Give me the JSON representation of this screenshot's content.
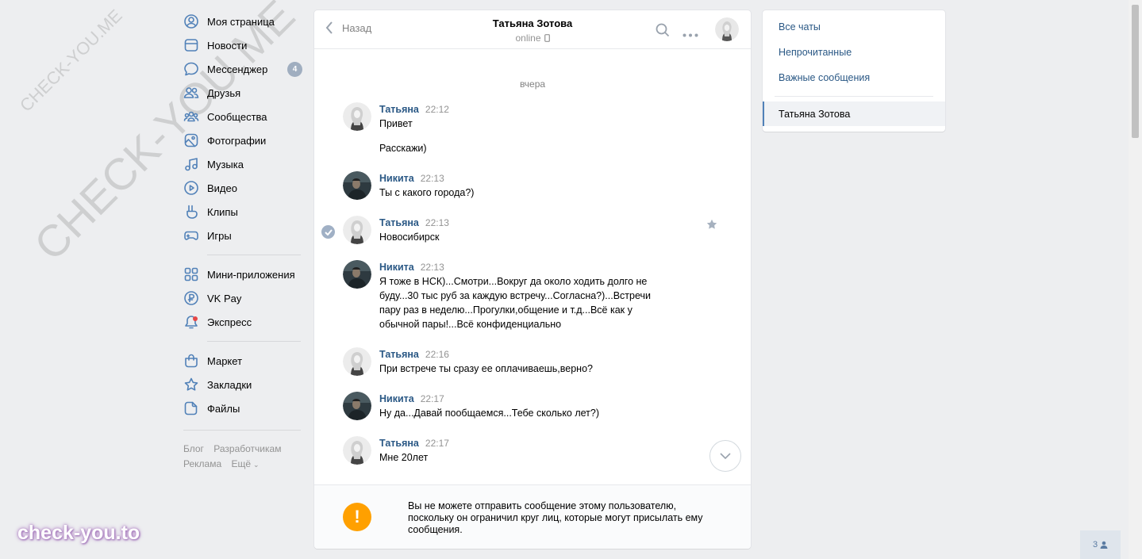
{
  "sidebar": {
    "items": [
      {
        "label": "Моя страница",
        "icon": "user-circle-icon"
      },
      {
        "label": "Новости",
        "icon": "news-icon"
      },
      {
        "label": "Мессенджер",
        "icon": "message-icon",
        "badge": "4"
      },
      {
        "label": "Друзья",
        "icon": "friends-icon"
      },
      {
        "label": "Сообщества",
        "icon": "communities-icon"
      },
      {
        "label": "Фотографии",
        "icon": "photos-icon"
      },
      {
        "label": "Музыка",
        "icon": "music-icon"
      },
      {
        "label": "Видео",
        "icon": "video-icon"
      },
      {
        "label": "Клипы",
        "icon": "clips-icon"
      },
      {
        "label": "Игры",
        "icon": "games-icon"
      }
    ],
    "items2": [
      {
        "label": "Мини-приложения",
        "icon": "apps-icon"
      },
      {
        "label": "VK Pay",
        "icon": "vkpay-icon"
      },
      {
        "label": "Экспресс",
        "icon": "express-icon"
      }
    ],
    "items3": [
      {
        "label": "Маркет",
        "icon": "market-icon"
      },
      {
        "label": "Закладки",
        "icon": "bookmarks-icon"
      },
      {
        "label": "Файлы",
        "icon": "files-icon"
      }
    ],
    "footer": {
      "blog": "Блог",
      "developers": "Разработчикам",
      "ads": "Реклама",
      "more": "Ещё"
    }
  },
  "chat": {
    "back_label": "Назад",
    "peer_name": "Татьяна Зотова",
    "peer_status": "online",
    "date_separator": "вчера",
    "messages": [
      {
        "author": "Татьяна",
        "time": "22:12",
        "text": "Привет",
        "extra": "Расскажи)"
      },
      {
        "author": "Никита",
        "time": "22:13",
        "text": "Ты с какого города?)"
      },
      {
        "author": "Татьяна",
        "time": "22:13",
        "text": "Новосибирск"
      },
      {
        "author": "Никита",
        "time": "22:13",
        "text": "Я тоже в НСК)...Смотри...Вокруг да около ходить долго не буду...30 тыс руб за каждую встречу...Согласна?)...Встречи пару раз в неделю...Прогулки,общение и т.д...Всё как у обычной пары!...Всё конфиденциально"
      },
      {
        "author": "Татьяна",
        "time": "22:16",
        "text": "При встрече ты сразу ее оплачиваешь,верно?"
      },
      {
        "author": "Никита",
        "time": "22:17",
        "text": "Ну да...Давай пообщаемся...Тебе сколько лет?)"
      },
      {
        "author": "Татьяна",
        "time": "22:17",
        "text": "Мне 20лет"
      }
    ],
    "blocked_notice": "Вы не можете отправить сообщение этому пользователю, поскольку он ограничил круг лиц, которые могут присылать ему сообщения.",
    "warning_glyph": "!"
  },
  "right_panel": {
    "all_chats": "Все чаты",
    "unread": "Непрочитанные",
    "important": "Важные сообщения",
    "active_chat": "Татьяна Зотова"
  },
  "online_friends": "3",
  "watermarks": {
    "big": "CHECK-YOU.ME",
    "small": "CHECK-YOU.ME",
    "logo": "check-you.to"
  },
  "colors": {
    "link": "#2a5885",
    "accent": "#5181b8",
    "warning": "#ffa000",
    "background": "#edeef0"
  }
}
